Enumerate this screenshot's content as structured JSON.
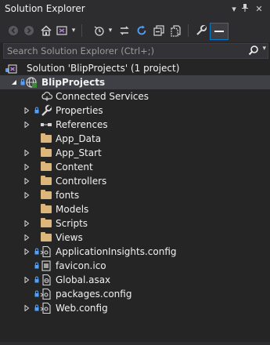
{
  "window": {
    "title": "Solution Explorer",
    "dropdown_glyph": "▾",
    "pin_glyph": "⊥",
    "close_glyph": "✕"
  },
  "search": {
    "placeholder": "Search Solution Explorer (Ctrl+;)"
  },
  "tree": {
    "solution": {
      "label": "Solution 'BlipProjects' (1 project)"
    },
    "project": {
      "label": "BlipProjects"
    },
    "items": [
      {
        "label": "Connected Services",
        "icon": "cloud-icon",
        "expandable": false
      },
      {
        "label": "Properties",
        "icon": "wrench-icon",
        "expandable": true
      },
      {
        "label": "References",
        "icon": "references-icon",
        "expandable": true
      },
      {
        "label": "App_Data",
        "icon": "folder-icon",
        "expandable": false
      },
      {
        "label": "App_Start",
        "icon": "folder-icon",
        "expandable": true
      },
      {
        "label": "Content",
        "icon": "folder-icon",
        "expandable": true
      },
      {
        "label": "Controllers",
        "icon": "folder-icon",
        "expandable": true
      },
      {
        "label": "fonts",
        "icon": "folder-icon",
        "expandable": true
      },
      {
        "label": "Models",
        "icon": "folder-icon",
        "expandable": false
      },
      {
        "label": "Scripts",
        "icon": "folder-icon",
        "expandable": true
      },
      {
        "label": "Views",
        "icon": "folder-icon",
        "expandable": true
      },
      {
        "label": "ApplicationInsights.config",
        "icon": "config-file-icon",
        "expandable": true
      },
      {
        "label": "favicon.ico",
        "icon": "ico-file-icon",
        "expandable": false
      },
      {
        "label": "Global.asax",
        "icon": "asax-file-icon",
        "expandable": true
      },
      {
        "label": "packages.config",
        "icon": "config-file-icon",
        "expandable": false
      },
      {
        "label": "Web.config",
        "icon": "config-file-icon",
        "expandable": true
      }
    ]
  },
  "colors": {
    "background": "#252526",
    "toolbar": "#2d2d30",
    "selection": "#3f3f46",
    "folder": "#dcb67a",
    "lock": "#4fa0ff",
    "accent": "#007acc"
  }
}
